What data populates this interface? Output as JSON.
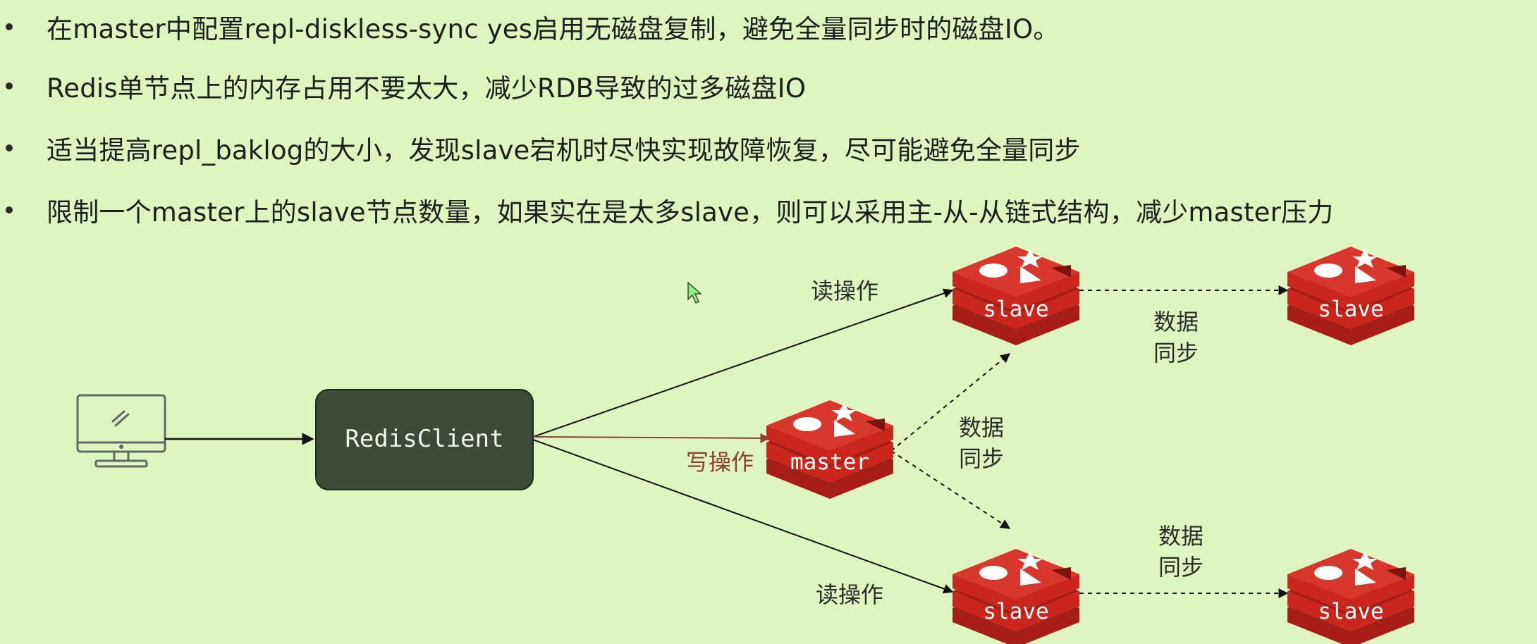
{
  "bullets": [
    "在master中配置repl-diskless-sync yes启用无磁盘复制，避免全量同步时的磁盘IO。",
    "Redis单节点上的内存占用不要太大，减少RDB导致的过多磁盘IO",
    "适当提高repl_baklog的大小，发现slave宕机时尽快实现故障恢复，尽可能避免全量同步",
    "限制一个master上的slave节点数量，如果实在是太多slave，则可以采用主-从-从链式结构，减少master压力"
  ],
  "diagram": {
    "client_label": "RedisClient",
    "master_label": "master",
    "slave_label": "slave",
    "read_label": "读操作",
    "write_label": "写操作",
    "sync_line1": "数据",
    "sync_line2": "同步"
  },
  "colors": {
    "background": "#dff5c0",
    "client_box": "#3c4a37",
    "redis_red": "#c9271c",
    "write_arrow": "#8a3f35"
  },
  "icons": [
    "monitor-icon",
    "redis-logo-icon",
    "cursor-icon"
  ]
}
